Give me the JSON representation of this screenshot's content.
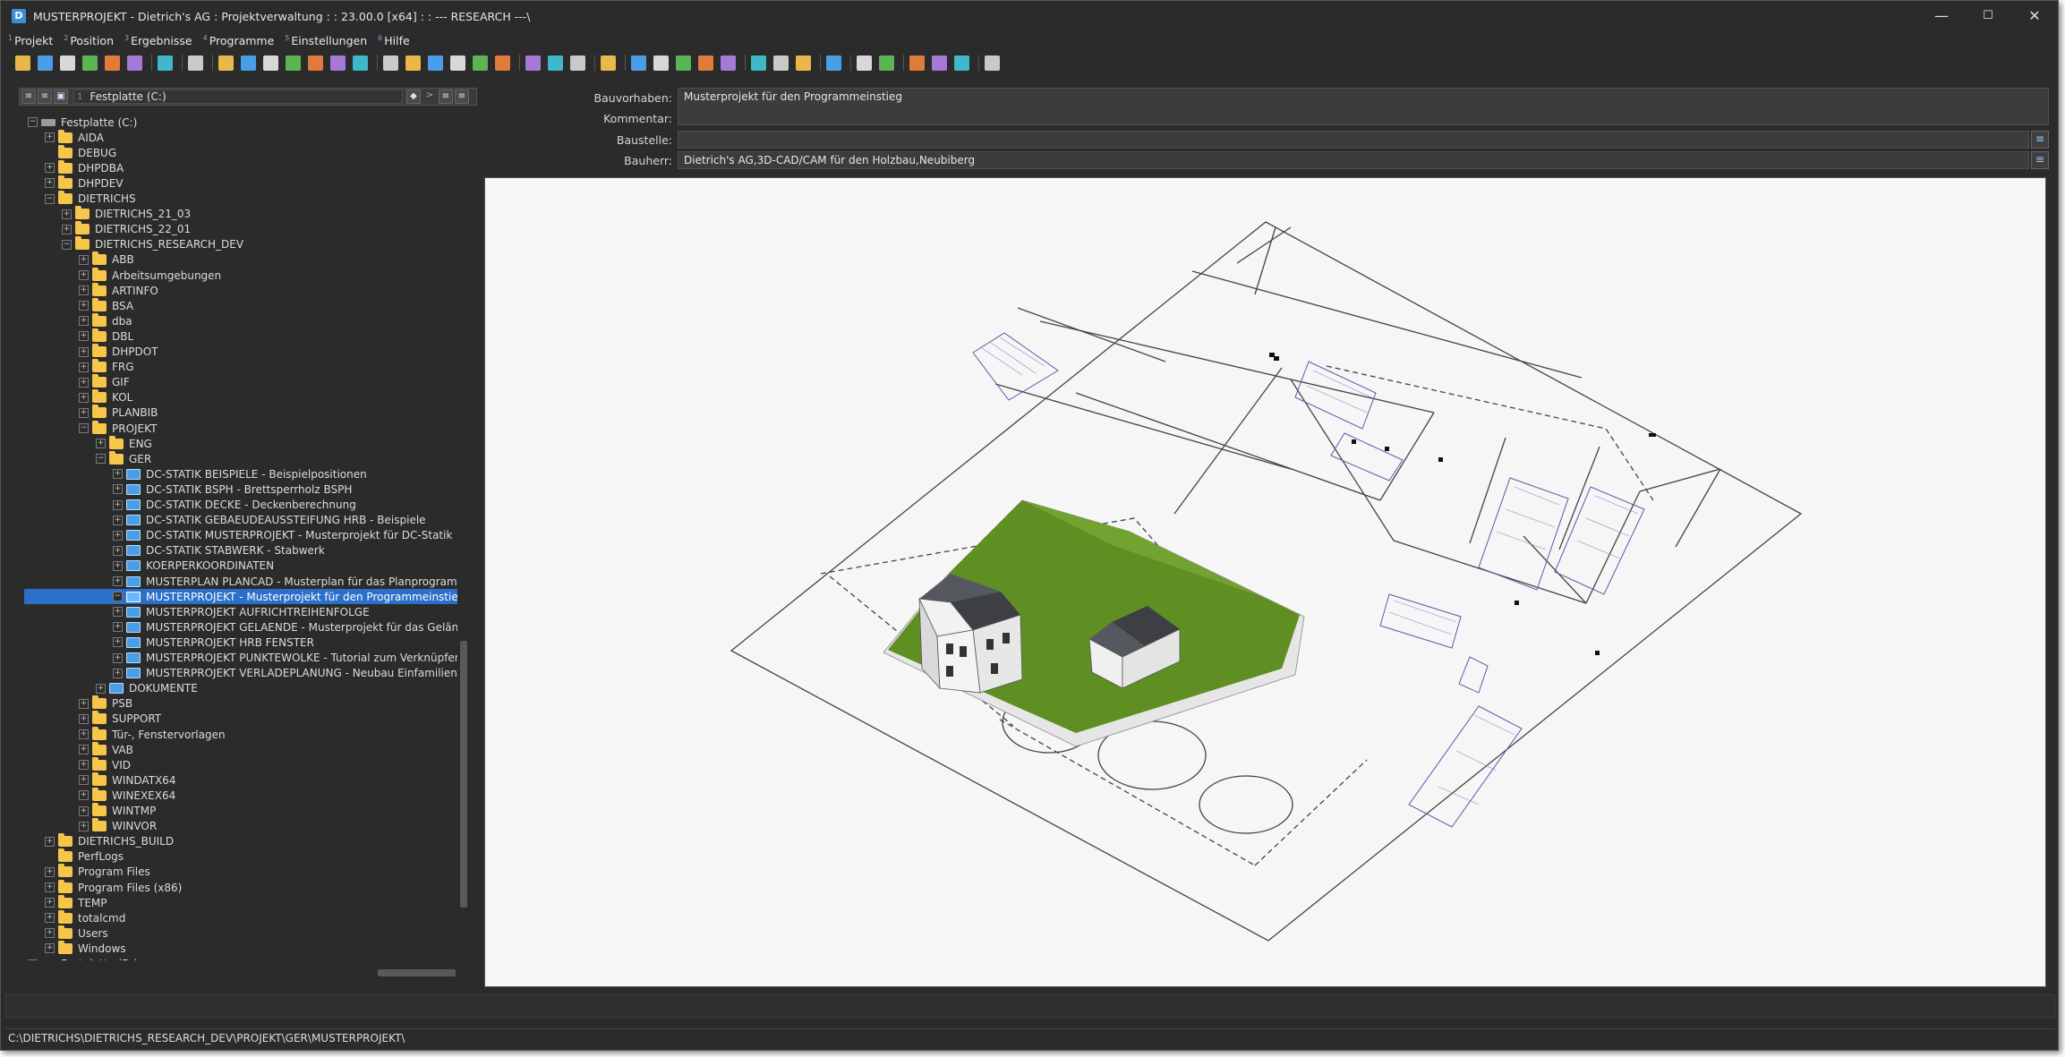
{
  "window": {
    "title": "MUSTERPROJEKT - Dietrich's AG : Projektverwaltung : : 23.00.0 [x64] : : --- RESEARCH ---\\",
    "app_icon": "D",
    "controls": {
      "minimize": "—",
      "maximize": "☐",
      "close": "✕"
    }
  },
  "menu": [
    {
      "num": "1",
      "label": "Projekt"
    },
    {
      "num": "2",
      "label": "Position"
    },
    {
      "num": "3",
      "label": "Ergebnisse"
    },
    {
      "num": "4",
      "label": "Programme"
    },
    {
      "num": "5",
      "label": "Einstellungen"
    },
    {
      "num": "6",
      "label": "Hilfe"
    }
  ],
  "toolbar_icons": [
    "open-folder-icon",
    "new-project-icon",
    "print-icon",
    "save-icon",
    "export-icon",
    "import-icon",
    "separator",
    "bookmark-icon",
    "separator",
    "network-icon",
    "separator",
    "project-list-icon",
    "check-icon",
    "copy-icon",
    "paste-icon",
    "delete-icon",
    "archive-icon",
    "properties-icon",
    "separator",
    "file-icon",
    "open-icon",
    "picture-icon",
    "cut-icon",
    "arrow-icon",
    "move-icon",
    "separator",
    "filter-icon",
    "filter-edit-icon",
    "sort-icon",
    "separator",
    "table-icon",
    "separator",
    "database-icon",
    "layers-icon",
    "report-icon",
    "grid-icon",
    "transfer-icon",
    "separator",
    "link-icon",
    "assembly-icon",
    "globe-icon",
    "separator",
    "download-icon",
    "separator",
    "help-icon",
    "info-icon",
    "separator",
    "upload-icon",
    "sync-icon",
    "web-icon",
    "separator",
    "bag-icon"
  ],
  "tree_header": {
    "num": "1",
    "drive": "Festplatte (C:)"
  },
  "tree": [
    {
      "label": "Festplatte (C:)",
      "level": 0,
      "icon": "drive",
      "exp": "-"
    },
    {
      "label": "AIDA",
      "level": 1,
      "icon": "folder",
      "exp": "+"
    },
    {
      "label": "DEBUG",
      "level": 1,
      "icon": "folder",
      "exp": ""
    },
    {
      "label": "DHPDBA",
      "level": 1,
      "icon": "folder",
      "exp": "+"
    },
    {
      "label": "DHPDEV",
      "level": 1,
      "icon": "folder",
      "exp": "+"
    },
    {
      "label": "DIETRICHS",
      "level": 1,
      "icon": "folder",
      "exp": "-"
    },
    {
      "label": "DIETRICHS_21_03",
      "level": 2,
      "icon": "folder",
      "exp": "+"
    },
    {
      "label": "DIETRICHS_22_01",
      "level": 2,
      "icon": "folder",
      "exp": "+"
    },
    {
      "label": "DIETRICHS_RESEARCH_DEV",
      "level": 2,
      "icon": "folder",
      "exp": "-"
    },
    {
      "label": "ABB",
      "level": 3,
      "icon": "folder",
      "exp": "+"
    },
    {
      "label": "Arbeitsumgebungen",
      "level": 3,
      "icon": "folder",
      "exp": "+"
    },
    {
      "label": "ARTINFO",
      "level": 3,
      "icon": "folder",
      "exp": "+"
    },
    {
      "label": "BSA",
      "level": 3,
      "icon": "folder",
      "exp": "+"
    },
    {
      "label": "dba",
      "level": 3,
      "icon": "folder",
      "exp": "+"
    },
    {
      "label": "DBL",
      "level": 3,
      "icon": "folder",
      "exp": "+"
    },
    {
      "label": "DHPDOT",
      "level": 3,
      "icon": "folder",
      "exp": "+"
    },
    {
      "label": "FRG",
      "level": 3,
      "icon": "folder",
      "exp": "+"
    },
    {
      "label": "GIF",
      "level": 3,
      "icon": "folder",
      "exp": "+"
    },
    {
      "label": "KOL",
      "level": 3,
      "icon": "folder",
      "exp": "+"
    },
    {
      "label": "PLANBIB",
      "level": 3,
      "icon": "folder",
      "exp": "+"
    },
    {
      "label": "PROJEKT",
      "level": 3,
      "icon": "folder",
      "exp": "-"
    },
    {
      "label": "ENG",
      "level": 4,
      "icon": "folder",
      "exp": "+"
    },
    {
      "label": "GER",
      "level": 4,
      "icon": "folder",
      "exp": "-"
    },
    {
      "label": "DC-STATIK BEISPIELE - Beispielpositionen",
      "level": 5,
      "icon": "proj",
      "exp": "+"
    },
    {
      "label": "DC-STATIK BSPH - Brettsperrholz BSPH",
      "level": 5,
      "icon": "proj",
      "exp": "+"
    },
    {
      "label": "DC-STATIK DECKE - Deckenberechnung",
      "level": 5,
      "icon": "proj",
      "exp": "+"
    },
    {
      "label": "DC-STATIK GEBAEUDEAUSSTEIFUNG HRB - Beispiele",
      "level": 5,
      "icon": "proj",
      "exp": "+"
    },
    {
      "label": "DC-STATIK MUSTERPROJEKT - Musterprojekt für DC-Statik",
      "level": 5,
      "icon": "proj",
      "exp": "+"
    },
    {
      "label": "DC-STATIK STABWERK - Stabwerk",
      "level": 5,
      "icon": "proj",
      "exp": "+"
    },
    {
      "label": "KOERPERKOORDINATEN",
      "level": 5,
      "icon": "proj",
      "exp": "+"
    },
    {
      "label": "MUSTERPLAN PLANCAD - Musterplan für das Planprogramm",
      "level": 5,
      "icon": "proj",
      "exp": "+"
    },
    {
      "label": "MUSTERPROJEKT - Musterprojekt für den Programmeinstieg",
      "level": 5,
      "icon": "proj-open",
      "exp": "-",
      "selected": true
    },
    {
      "label": "MUSTERPROJEKT AUFRICHTREIHENFOLGE",
      "level": 5,
      "icon": "proj",
      "exp": "+"
    },
    {
      "label": "MUSTERPROJEKT GELAENDE - Musterprojekt für das Gelände",
      "level": 5,
      "icon": "proj",
      "exp": "+"
    },
    {
      "label": "MUSTERPROJEKT HRB FENSTER",
      "level": 5,
      "icon": "proj",
      "exp": "+"
    },
    {
      "label": "MUSTERPROJEKT PUNKTEWOLKE - Tutorial zum Verknüpfen",
      "level": 5,
      "icon": "proj",
      "exp": "+"
    },
    {
      "label": "MUSTERPROJEKT VERLADEPLANUNG - Neubau Einfamilienhaus",
      "level": 5,
      "icon": "proj",
      "exp": "+"
    },
    {
      "label": "DOKUMENTE",
      "level": 4,
      "icon": "proj",
      "exp": "+"
    },
    {
      "label": "PSB",
      "level": 3,
      "icon": "folder",
      "exp": "+"
    },
    {
      "label": "SUPPORT",
      "level": 3,
      "icon": "folder",
      "exp": "+"
    },
    {
      "label": "Tür-, Fenstervorlagen",
      "level": 3,
      "icon": "folder",
      "exp": "+"
    },
    {
      "label": "VAB",
      "level": 3,
      "icon": "folder",
      "exp": "+"
    },
    {
      "label": "VID",
      "level": 3,
      "icon": "folder",
      "exp": "+"
    },
    {
      "label": "WINDATX64",
      "level": 3,
      "icon": "folder",
      "exp": "+"
    },
    {
      "label": "WINEXEX64",
      "level": 3,
      "icon": "folder",
      "exp": "+"
    },
    {
      "label": "WINTMP",
      "level": 3,
      "icon": "folder",
      "exp": "+"
    },
    {
      "label": "WINVOR",
      "level": 3,
      "icon": "folder",
      "exp": "+"
    },
    {
      "label": "DIETRICHS_BUILD",
      "level": 1,
      "icon": "folder",
      "exp": "+"
    },
    {
      "label": "PerfLogs",
      "level": 1,
      "icon": "folder",
      "exp": ""
    },
    {
      "label": "Program Files",
      "level": 1,
      "icon": "folder",
      "exp": "+"
    },
    {
      "label": "Program Files (x86)",
      "level": 1,
      "icon": "folder",
      "exp": "+"
    },
    {
      "label": "TEMP",
      "level": 1,
      "icon": "folder",
      "exp": "+"
    },
    {
      "label": "totalcmd",
      "level": 1,
      "icon": "folder",
      "exp": "+"
    },
    {
      "label": "Users",
      "level": 1,
      "icon": "folder",
      "exp": "+"
    },
    {
      "label": "Windows",
      "level": 1,
      "icon": "folder",
      "exp": "+"
    },
    {
      "label": "Festplatte (D:)",
      "level": 0,
      "icon": "drive",
      "exp": "+"
    }
  ],
  "props": {
    "bauvorhaben": {
      "label": "Bauvorhaben:",
      "value": "Musterprojekt für den Programmeinstieg"
    },
    "kommentar": {
      "label": "Kommentar:",
      "value": ""
    },
    "baustelle": {
      "label": "Baustelle:",
      "value": ""
    },
    "bauherr": {
      "label": "Bauherr:",
      "value": "Dietrich's AG,3D-CAD/CAM für den Holzbau,Neubiberg"
    }
  },
  "statusbar": {
    "path": "C:\\DIETRICHS\\DIETRICHS_RESEARCH_DEV\\PROJEKT\\GER\\MUSTERPROJEKT\\"
  },
  "colors": {
    "selection": "#2a6fc9",
    "folder": "#f5c64a",
    "grass": "#5f8f23",
    "roof": "#3d3f45"
  }
}
